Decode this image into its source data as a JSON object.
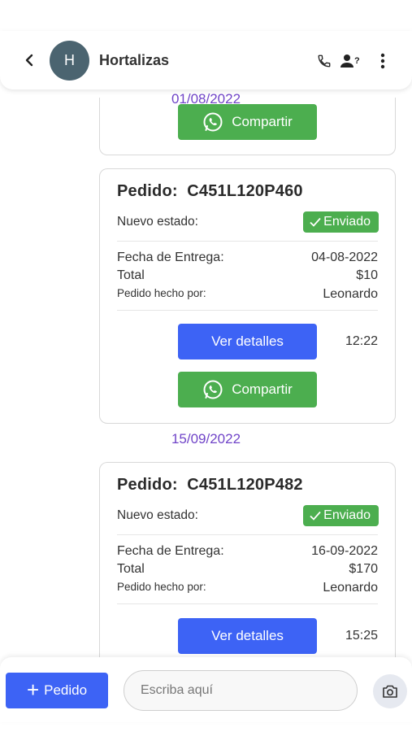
{
  "header": {
    "avatar_letter": "H",
    "title": "Hortalizas"
  },
  "dates": [
    "01/08/2022",
    "15/09/2022"
  ],
  "partial_card": {
    "share_label": "Compartir"
  },
  "orders": [
    {
      "title_prefix": "Pedido:",
      "code": "C451L120P460",
      "state_label": "Nuevo estado:",
      "state_value": "Enviado",
      "delivery_label": "Fecha de Entrega:",
      "delivery_value": "04-08-2022",
      "total_label": "Total",
      "total_value": "$10",
      "by_label": "Pedido hecho por:",
      "by_value": "Leonardo",
      "details_label": "Ver detalles",
      "time": "12:22",
      "share_label": "Compartir"
    },
    {
      "title_prefix": "Pedido:",
      "code": "C451L120P482",
      "state_label": "Nuevo estado:",
      "state_value": "Enviado",
      "delivery_label": "Fecha de Entrega:",
      "delivery_value": "16-09-2022",
      "total_label": "Total",
      "total_value": "$170",
      "by_label": "Pedido hecho por:",
      "by_value": "Leonardo",
      "details_label": "Ver detalles",
      "time": "15:25"
    }
  ],
  "bottom": {
    "pedido_label": "Pedido",
    "input_placeholder": "Escriba aquí"
  },
  "icons": {
    "back": "chevron-left-icon",
    "call": "phone-icon",
    "contact": "person-question-icon",
    "menu": "more-vertical-icon",
    "whatsapp": "whatsapp-icon",
    "check": "check-icon",
    "plus": "plus-icon",
    "camera": "camera-icon"
  },
  "colors": {
    "primary": "#3d63f5",
    "success": "#4cae4f",
    "date": "#7044c8",
    "avatar": "#4b6470"
  }
}
